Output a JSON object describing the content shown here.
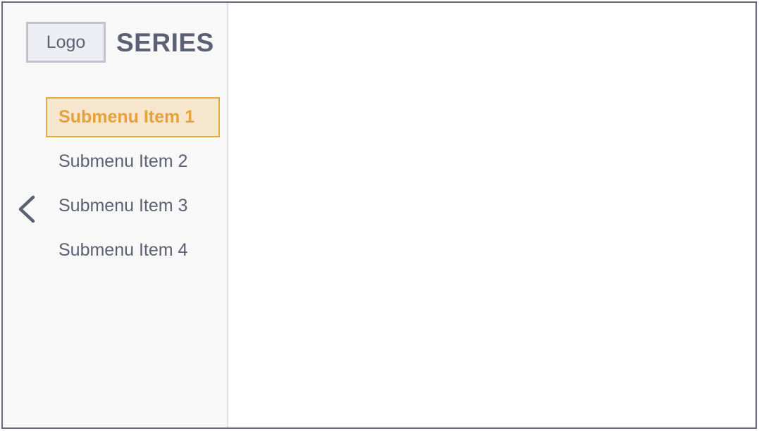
{
  "brand": {
    "logo_label": "Logo",
    "title": "SERIES"
  },
  "sidebar": {
    "items": [
      {
        "label": "Submenu Item 1",
        "active": true
      },
      {
        "label": "Submenu Item 2",
        "active": false
      },
      {
        "label": "Submenu Item 3",
        "active": false
      },
      {
        "label": "Submenu Item 4",
        "active": false
      }
    ],
    "collapse_icon": "chevron-left-icon"
  },
  "colors": {
    "accent": "#e5a23a",
    "accent_bg": "#f6e6cd",
    "text": "#5b6073",
    "sidebar_bg": "#f8f8f8",
    "border": "#656a7a"
  }
}
